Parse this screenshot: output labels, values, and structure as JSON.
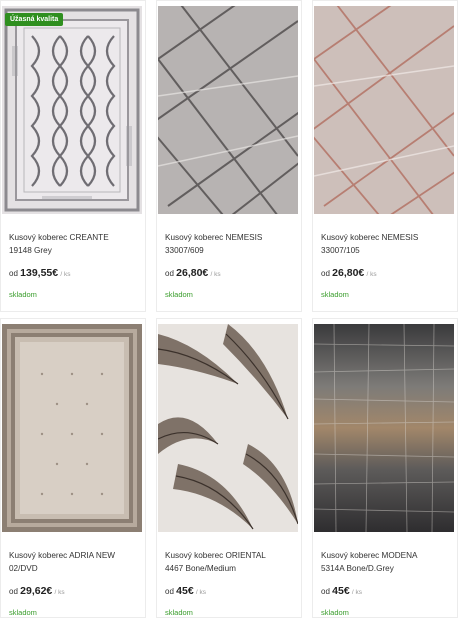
{
  "products": [
    {
      "badge": "Úžasná kvalita",
      "name_line1": "Kusový koberec CREANTE",
      "name_line2": "19148 Grey",
      "price_prefix": "od",
      "price": "139,55€",
      "price_unit": "/ ks",
      "stock": "skladom",
      "image": "rug-creante-grey"
    },
    {
      "badge": "",
      "name_line1": "Kusový koberec NEMESIS",
      "name_line2": "33007/609",
      "price_prefix": "od",
      "price": "26,80€",
      "price_unit": "/ ks",
      "stock": "skladom",
      "image": "rug-nemesis-609"
    },
    {
      "badge": "",
      "name_line1": "Kusový koberec NEMESIS",
      "name_line2": "33007/105",
      "price_prefix": "od",
      "price": "26,80€",
      "price_unit": "/ ks",
      "stock": "skladom",
      "image": "rug-nemesis-105"
    },
    {
      "badge": "",
      "name_line1": "Kusový koberec ADRIA NEW",
      "name_line2": "02/DVD",
      "price_prefix": "od",
      "price": "29,62€",
      "price_unit": "/ ks",
      "stock": "skladom",
      "image": "rug-adria-new"
    },
    {
      "badge": "",
      "name_line1": "Kusový koberec ORIENTAL",
      "name_line2": "4467 Bone/Medium",
      "price_prefix": "od",
      "price": "45€",
      "price_unit": "/ ks",
      "stock": "skladom",
      "image": "rug-oriental-feathers"
    },
    {
      "badge": "",
      "name_line1": "Kusový koberec MODENA",
      "name_line2": "5314A Bone/D.Grey",
      "price_prefix": "od",
      "price": "45€",
      "price_unit": "/ ks",
      "stock": "skladom",
      "image": "rug-modena-abstract"
    }
  ],
  "colors": {
    "accent_green": "#2f8f1f",
    "stock_green": "#3a9d2c"
  }
}
